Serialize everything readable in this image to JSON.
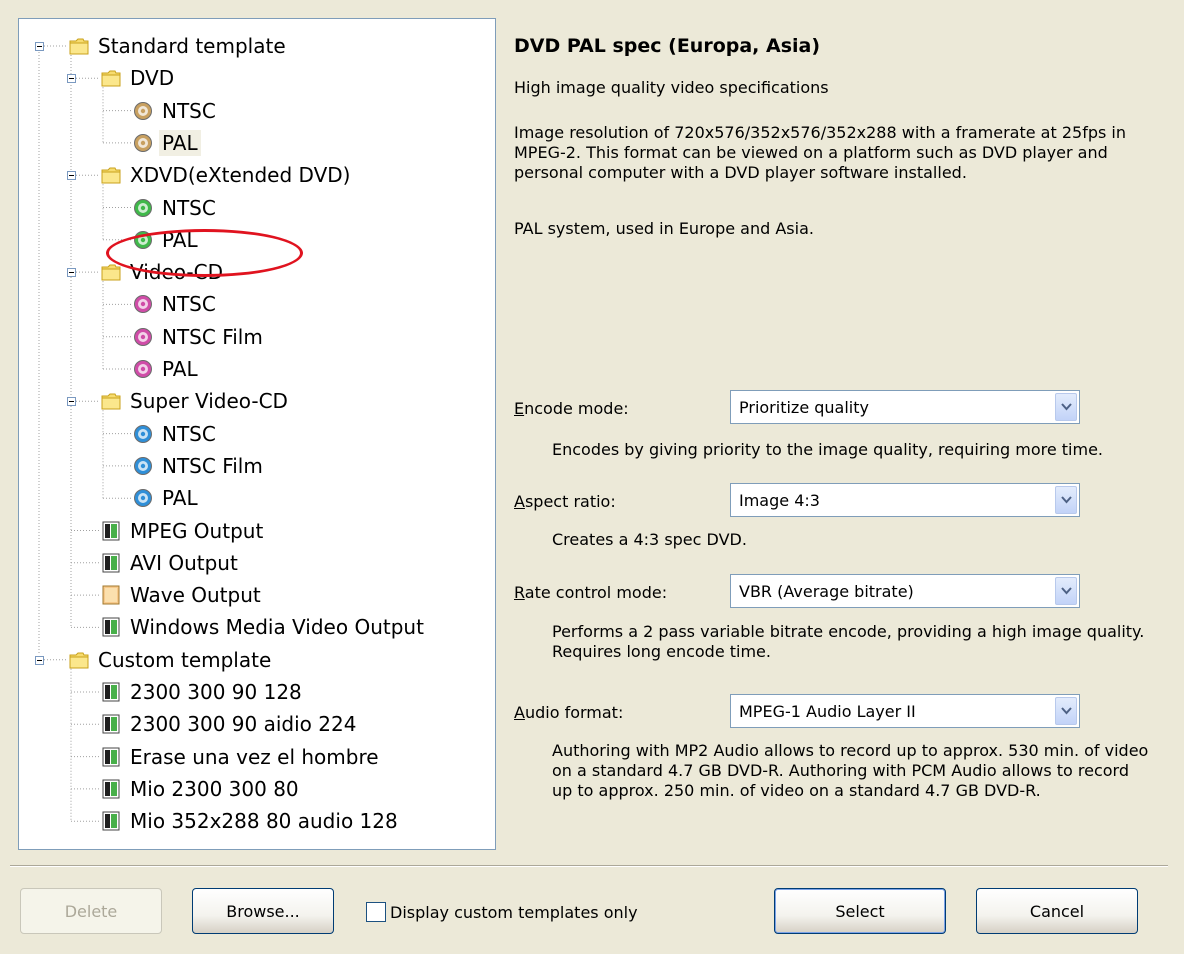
{
  "tree": {
    "root_standard": {
      "label": "Standard template",
      "icon": "folder-icon"
    },
    "dvd": {
      "label": "DVD",
      "icon": "folder-icon"
    },
    "dvd_ntsc": {
      "label": "NTSC",
      "icon": "disc-icon"
    },
    "dvd_pal": {
      "label": "PAL",
      "icon": "disc-icon"
    },
    "xdvd": {
      "label": "XDVD(eXtended DVD)",
      "icon": "folder-icon"
    },
    "xdvd_ntsc": {
      "label": "NTSC",
      "icon": "disc-icon"
    },
    "xdvd_pal": {
      "label": "PAL",
      "icon": "disc-icon"
    },
    "vcd": {
      "label": "Video-CD",
      "icon": "folder-icon"
    },
    "vcd_ntsc": {
      "label": "NTSC",
      "icon": "disc-icon"
    },
    "vcd_ntsc_film": {
      "label": "NTSC Film",
      "icon": "disc-icon"
    },
    "vcd_pal": {
      "label": "PAL",
      "icon": "disc-icon"
    },
    "svcd": {
      "label": "Super Video-CD",
      "icon": "folder-icon"
    },
    "svcd_ntsc": {
      "label": "NTSC",
      "icon": "disc-icon"
    },
    "svcd_ntsc_film": {
      "label": "NTSC Film",
      "icon": "disc-icon"
    },
    "svcd_pal": {
      "label": "PAL",
      "icon": "disc-icon"
    },
    "mpeg_output": {
      "label": "MPEG Output",
      "icon": "file-icon"
    },
    "avi_output": {
      "label": "AVI Output",
      "icon": "file-icon"
    },
    "wave_output": {
      "label": "Wave Output",
      "icon": "audio-file-icon"
    },
    "wmv_output": {
      "label": "Windows Media Video Output",
      "icon": "file-icon"
    },
    "root_custom": {
      "label": "Custom template",
      "icon": "folder-icon"
    },
    "custom_1": {
      "label": "2300 300 90 128",
      "icon": "file-icon"
    },
    "custom_2": {
      "label": "2300 300 90 aidio 224",
      "icon": "file-icon"
    },
    "custom_3": {
      "label": "Erase una vez el hombre",
      "icon": "file-icon"
    },
    "custom_4": {
      "label": "Mio 2300 300 80",
      "icon": "file-icon"
    },
    "custom_5": {
      "label": "Mio 352x288 80 audio 128",
      "icon": "file-icon"
    },
    "selected": "dvd_pal",
    "highlighted": "xdvd_pal",
    "colors": {
      "dvd_disc": "#c8a060",
      "xdvd_disc": "#3fb94a",
      "vcd_disc": "#d04ca8",
      "svcd_disc": "#2f8fd8",
      "highlight_oval": "#e0131f"
    }
  },
  "details": {
    "title": "DVD PAL spec (Europa, Asia)",
    "subtitle": "High image quality video specifications",
    "description": "Image resolution of 720x576/352x576/352x288 with a framerate at 25fps in MPEG-2. This format can be viewed on a platform such as DVD player and personal computer with a DVD player software installed.",
    "system": "PAL system, used in Europe and Asia."
  },
  "options": {
    "encode_mode": {
      "label_u": "E",
      "label_rest": "ncode mode:",
      "value": "Prioritize quality",
      "note": "Encodes by giving priority to the image quality, requiring more time."
    },
    "aspect_ratio": {
      "label_u": "A",
      "label_rest": "spect ratio:",
      "value": "Image 4:3",
      "note": "Creates a 4:3 spec DVD."
    },
    "rate_control": {
      "label_u": "R",
      "label_rest": "ate control mode:",
      "value": "VBR (Average bitrate)",
      "note": "Performs a 2 pass variable bitrate encode, providing a high image quality. Requires long encode time."
    },
    "audio_format": {
      "label_u": "A",
      "label_rest": "udio format:",
      "value": "MPEG-1 Audio Layer II",
      "note": "Authoring with MP2 Audio allows to record up to approx. 530 min. of video on a standard 4.7 GB DVD-R. Authoring with PCM Audio allows to record up to approx. 250 min. of video on a standard 4.7 GB DVD-R."
    }
  },
  "buttons": {
    "delete": "Delete",
    "browse": "Browse...",
    "select": "Select",
    "cancel": "Cancel"
  },
  "checkbox": {
    "label": "Display custom templates only",
    "checked": false
  }
}
